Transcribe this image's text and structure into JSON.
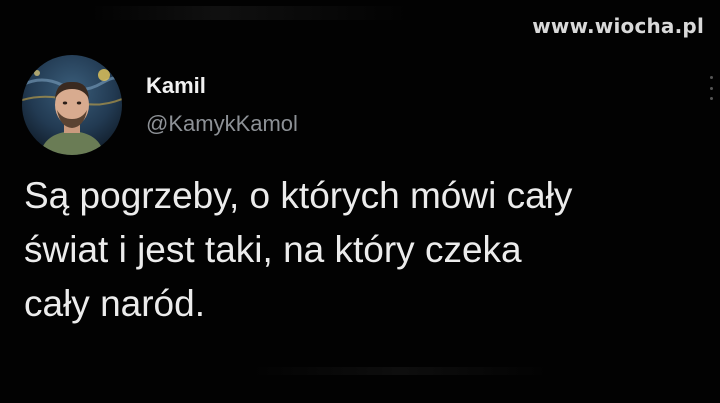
{
  "watermark": "www.wiocha.pl",
  "tweet": {
    "display_name": "Kamil",
    "handle": "@KamykKamol",
    "avatar_icon": "user-avatar-photo",
    "text_lines": [
      "Są pogrzeby, o których mówi cały",
      "świat i jest taki, na który czeka",
      "cały naród."
    ]
  },
  "colors": {
    "background": "#020202",
    "name": "#f2f2f2",
    "handle": "#8d9196",
    "text": "#ececec"
  }
}
